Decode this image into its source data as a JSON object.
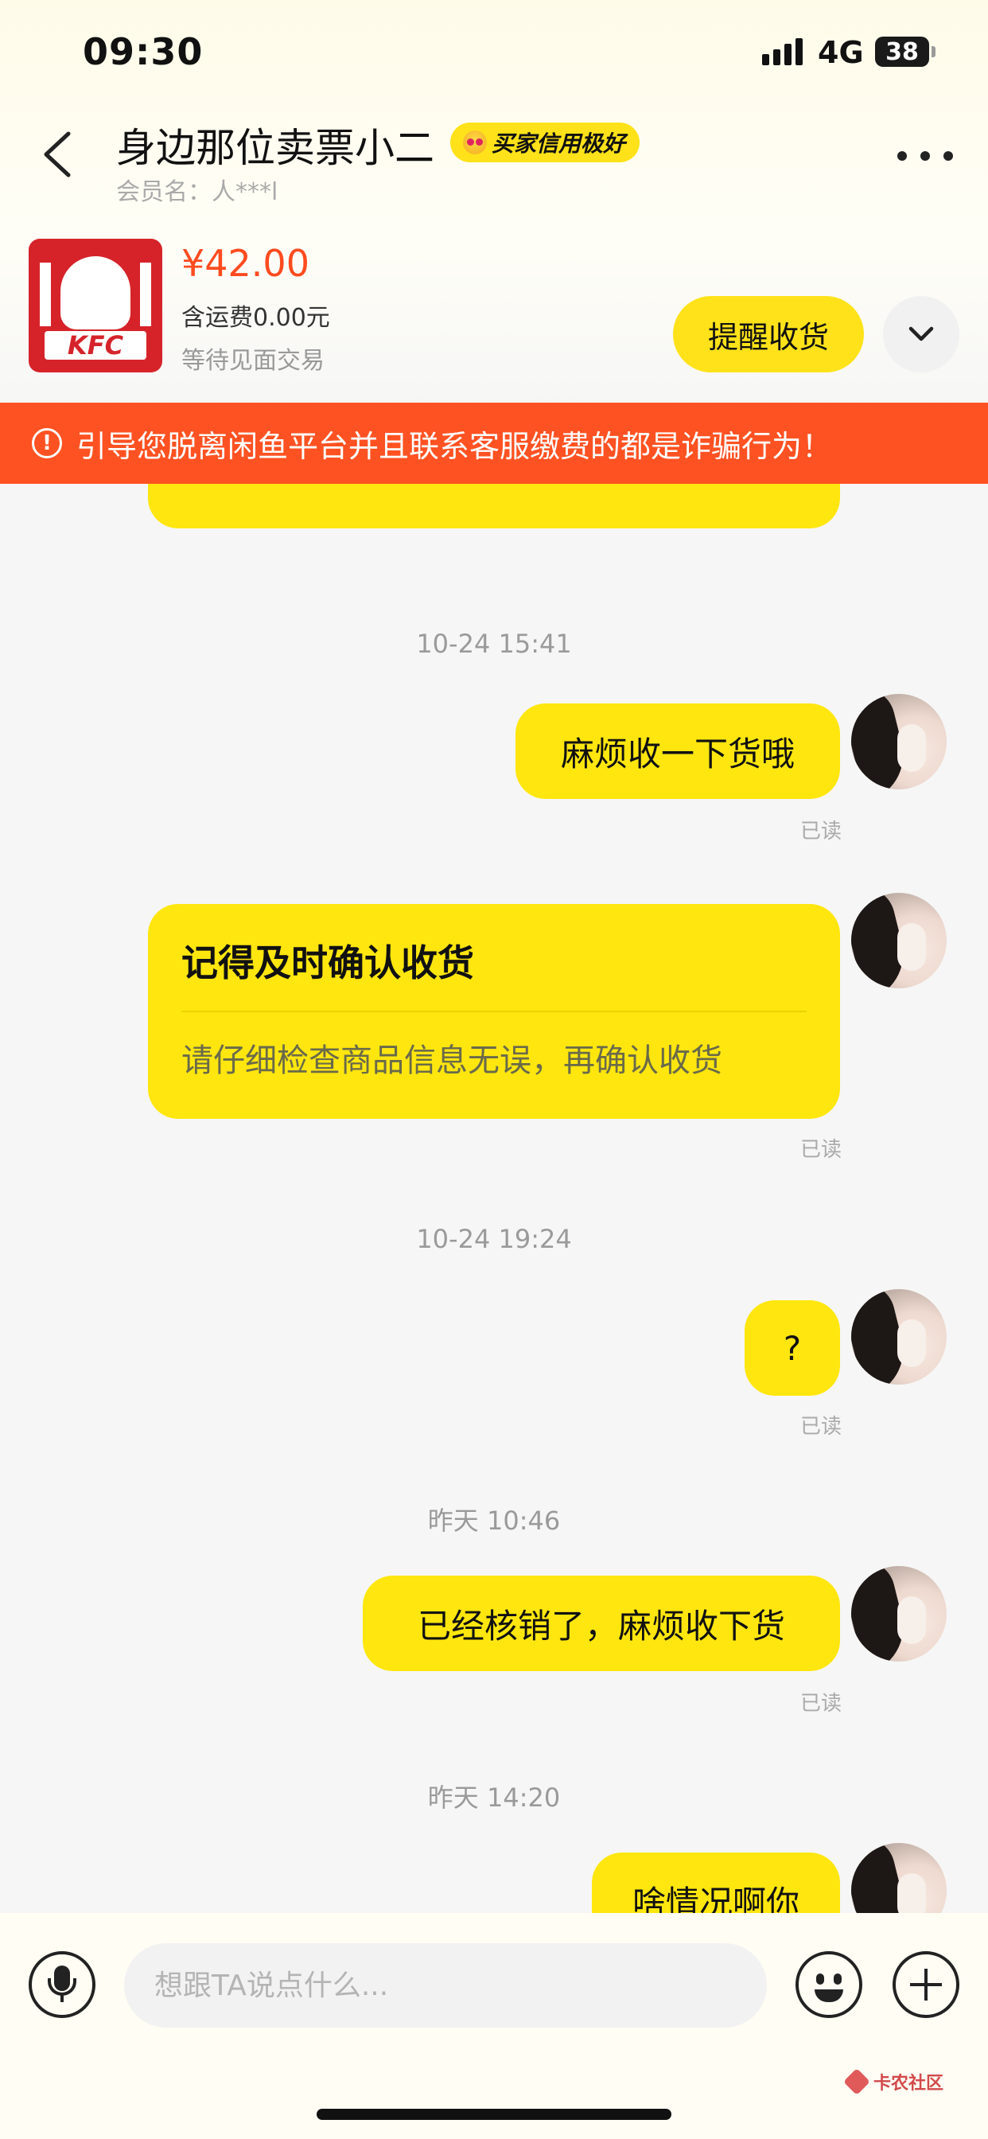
{
  "status_bar": {
    "time": "09:30",
    "network": "4G",
    "battery": "38"
  },
  "header": {
    "title": "身边那位卖票小二",
    "badge": "买家信用极好",
    "member": "会员名：人***l"
  },
  "product": {
    "price": "¥42.00",
    "shipping": "含运费0.00元",
    "status": "等待见面交易",
    "logo_text": "KFC",
    "remind_label": "提醒收货"
  },
  "warning": {
    "text": "引导您脱离闲鱼平台并且联系客服缴费的都是诈骗行为！"
  },
  "chat": {
    "stamp_1": "10-24 15:41",
    "msg_1": "麻烦收一下货哦",
    "read_1": "已读",
    "card_title": "记得及时确认收货",
    "card_sub": "请仔细检查商品信息无误，再确认收货",
    "read_2": "已读",
    "stamp_2": "10-24 19:24",
    "msg_2": "?",
    "read_3": "已读",
    "stamp_3": "昨天 10:46",
    "msg_3": "已经核销了，麻烦收下货",
    "read_4": "已读",
    "stamp_4": "昨天 14:20",
    "msg_4": "啥情况啊你"
  },
  "input": {
    "placeholder": "想跟TA说点什么..."
  },
  "watermark": "卡农社区",
  "colors": {
    "accent": "#ffe60f",
    "warning": "#ff5222",
    "price": "#ff4b1f",
    "brand_red": "#d6232a"
  }
}
